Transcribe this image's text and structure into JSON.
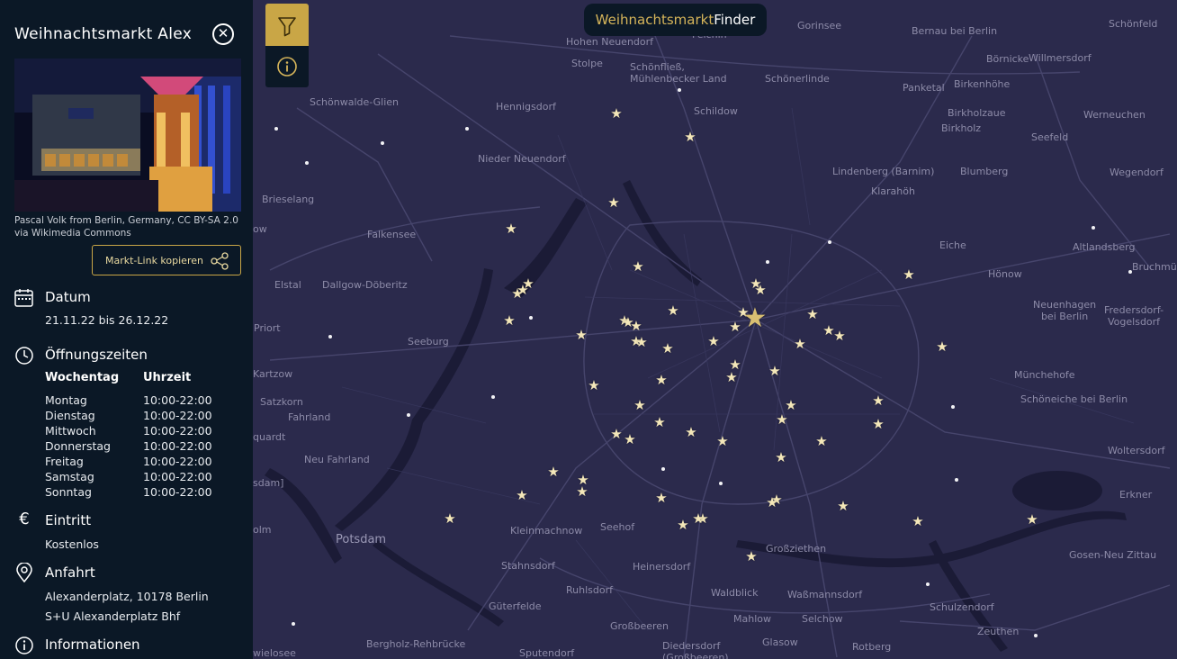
{
  "brand": {
    "part1": "Weihnachtsmarkt",
    "part2": "Finder"
  },
  "toolbar": {
    "filter_icon": "filter-icon",
    "info_icon": "info-icon"
  },
  "panel": {
    "title": "Weihnachtsmarkt Alex",
    "photo_credit": "Pascal Volk from Berlin, Germany, CC BY-SA 2.0 via Wikimedia Commons",
    "copy_link_label": "Markt-Link kopieren",
    "date": {
      "heading": "Datum",
      "value": "21.11.22 bis 26.12.22"
    },
    "hours": {
      "heading": "Öffnungszeiten",
      "col_day": "Wochentag",
      "col_time": "Uhrzeit",
      "rows": [
        {
          "day": "Montag",
          "time": "10:00-22:00"
        },
        {
          "day": "Dienstag",
          "time": "10:00-22:00"
        },
        {
          "day": "Mittwoch",
          "time": "10:00-22:00"
        },
        {
          "day": "Donnerstag",
          "time": "10:00-22:00"
        },
        {
          "day": "Freitag",
          "time": "10:00-22:00"
        },
        {
          "day": "Samstag",
          "time": "10:00-22:00"
        },
        {
          "day": "Sonntag",
          "time": "10:00-22:00"
        }
      ]
    },
    "entry": {
      "heading": "Eintritt",
      "value": "Kostenlos"
    },
    "directions": {
      "heading": "Anfahrt",
      "address": "Alexanderplatz, 10178 Berlin",
      "transit": "S+U Alexanderplatz Bhf"
    },
    "info": {
      "heading": "Informationen"
    }
  },
  "map": {
    "places": [
      "Felchin",
      "Gorinsee",
      "Bernau bei Berlin",
      "Schönfeld",
      "Hohen Neuendorf",
      "Schönfließ, Mühlenbecker Land",
      "Börnicke",
      "Willmersdorf",
      "Stolpe",
      "Schönerlinde",
      "Panketal",
      "Birkenhöhe",
      "Schönwalde-Glien",
      "Hennigsdorf",
      "Schildow",
      "Birkholzaue",
      "Werneuchen",
      "Birkholz",
      "Seefeld",
      "Nieder Neuendorf",
      "Lindenberg (Barnim)",
      "Blumberg",
      "Wegendorf",
      "Klarahöh",
      "Brieselang",
      "Falkensee",
      "Eiche",
      "Altlandsberg",
      "Bruchmühle",
      "Elstal",
      "Dallgow-Döberitz",
      "Hönow",
      "Neuenhagen bei Berlin",
      "Fredersdorf-Vogelsdorf",
      "Priort",
      "Seeburg",
      "Kartzow",
      "Münchehofe",
      "Satzkorn",
      "Schöneiche bei Berlin",
      "Fahrland",
      "Woltersdorf",
      "Neu Fahrland",
      "Erkner",
      "Potsdam",
      "Kleinmachnow",
      "Seehof",
      "Großziethen",
      "Gosen-Neu Zittau",
      "Stahnsdorf",
      "Heinersdorf",
      "Ruhlsdorf",
      "Waßmannsdorf",
      "Waldblick",
      "Güterfelde",
      "Schulzendorf",
      "Mahlow",
      "Selchow",
      "Großbeeren",
      "Zeuthen",
      "Bergholz-Rehbrücke",
      "Diedersdorf (Großbeeren)",
      "Glasow",
      "Rotberg",
      "Sputendorf",
      "wielosee",
      "olm",
      "sdam]",
      "quardt",
      "ow",
      "Berlin"
    ],
    "selected_market_icon": "star-icon"
  }
}
